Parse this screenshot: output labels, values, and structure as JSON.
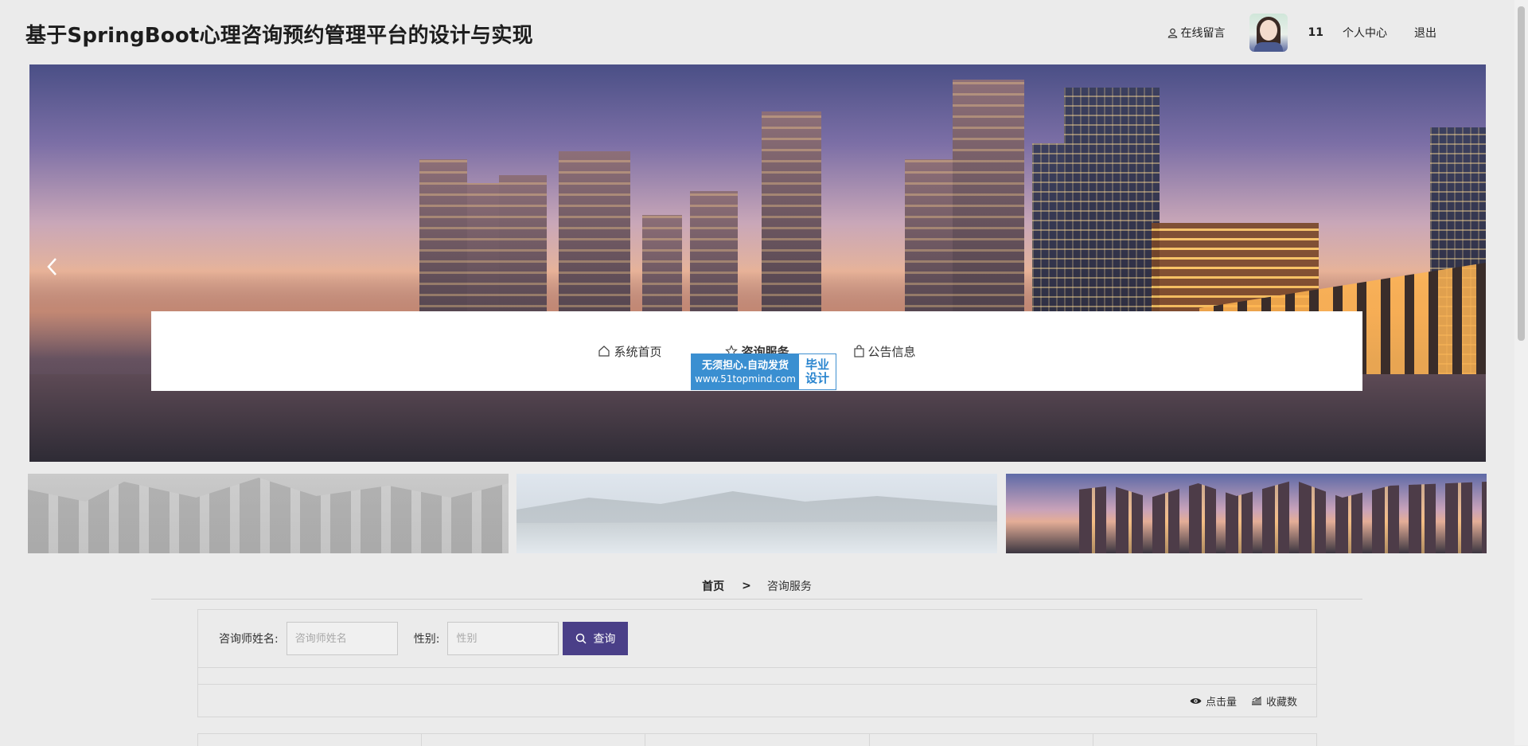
{
  "header": {
    "title": "基于SpringBoot心理咨询预约管理平台的设计与实现",
    "message_label": "在线留言",
    "username": "11",
    "personal_center_label": "个人中心",
    "logout_label": "退出"
  },
  "nav": {
    "items": [
      {
        "label": "系统首页",
        "icon": "home-icon"
      },
      {
        "label": "咨询服务",
        "icon": "star-icon",
        "active": true
      },
      {
        "label": "公告信息",
        "icon": "bag-icon"
      }
    ]
  },
  "promo": {
    "line1": "无须担心.自动发货",
    "line2": "www.51topmind.com",
    "right_line1": "毕业",
    "right_line2": "设计"
  },
  "breadcrumb": {
    "home": "首页",
    "separator": ">",
    "current": "咨询服务"
  },
  "search": {
    "name_label": "咨询师姓名:",
    "name_placeholder": "咨询师姓名",
    "gender_label": "性别:",
    "gender_placeholder": "性别",
    "button_label": "查询"
  },
  "sort": {
    "clicks_label": "点击量",
    "favorites_label": "收藏数"
  },
  "colors": {
    "accent": "#4a3f88",
    "promo_blue": "#3a8fd1"
  }
}
